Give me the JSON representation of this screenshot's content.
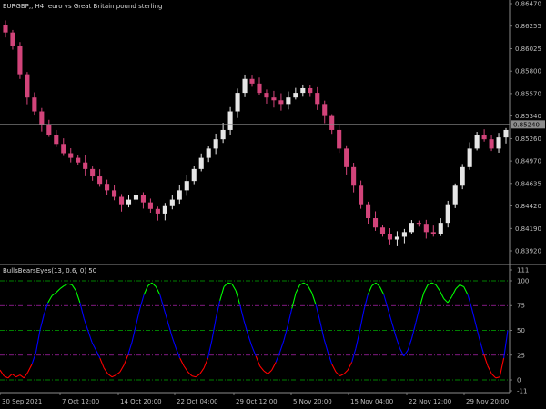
{
  "chart": {
    "title": "EURGBP,, H4:  euro vs Great Britain pound sterling",
    "price_axis_labels": [
      "0.86470",
      "0.86255",
      "0.86025",
      "0.85800",
      "0.85570",
      "0.85340",
      "0.85260",
      "0.84970",
      "0.84635",
      "0.84420",
      "0.84190",
      "0.83920"
    ],
    "current_price_label": "0.85240",
    "price_axis_range": [
      0.838,
      0.8656
    ],
    "current_price": 0.8526,
    "colors": {
      "background": "#000000",
      "bull": "#e6e6e6",
      "bear": "#d2447a",
      "separator": "#8c8c8c",
      "current_line": "#8c8c8c"
    }
  },
  "indicator": {
    "label": "BullsBearsEyes(13, 0.6, 0) 50",
    "axis_labels": [
      "111",
      "100",
      "75",
      "50",
      "25",
      "0",
      "-11"
    ],
    "range": [
      -11,
      111
    ],
    "levels": [
      100,
      75,
      50,
      25,
      0
    ],
    "colors": {
      "high": "#00ff00",
      "mid": "#0000ff",
      "low": "#ff0000",
      "level_100": "#00aa00",
      "level_75": "#aa22aa",
      "level_50": "#00aa00",
      "level_25": "#aa22aa",
      "level_0": "#00aa00"
    }
  },
  "time_axis": {
    "labels": [
      "30 Sep 2021",
      "7 Oct 12:00",
      "14 Oct 20:00",
      "22 Oct 04:00",
      "29 Oct 12:00",
      "5 Nov 20:00",
      "15 Nov 04:00",
      "22 Nov 12:00",
      "29 Nov 20:00"
    ]
  },
  "chart_data": {
    "type": "line",
    "series": [
      {
        "values": [
          0.8625,
          0.861,
          0.858,
          0.8555,
          0.854,
          0.8525,
          0.8515,
          0.8505,
          0.8495,
          0.849,
          0.8485,
          0.8478,
          0.847,
          0.8462,
          0.8455,
          0.8448,
          0.844,
          0.8445,
          0.845,
          0.8442,
          0.8435,
          0.843,
          0.8438,
          0.8445,
          0.8455,
          0.8465,
          0.8478,
          0.849,
          0.85,
          0.851,
          0.852,
          0.854,
          0.856,
          0.8575,
          0.857,
          0.856,
          0.8555,
          0.8552,
          0.8548,
          0.8555,
          0.856,
          0.8565,
          0.856,
          0.8548,
          0.8535,
          0.852,
          0.85,
          0.848,
          0.846,
          0.844,
          0.8425,
          0.8415,
          0.8408,
          0.8402,
          0.8405,
          0.841,
          0.842,
          0.8418,
          0.841,
          0.8408,
          0.842,
          0.844,
          0.846,
          0.848,
          0.85,
          0.8515,
          0.851,
          0.85,
          0.8512,
          0.852
        ]
      }
    ],
    "indicator_series": [
      {
        "values": [
          10,
          4,
          2,
          6,
          3,
          5,
          2,
          8,
          16,
          28,
          50,
          66,
          78,
          85,
          88,
          92,
          95,
          97,
          96,
          90,
          78,
          62,
          50,
          38,
          30,
          22,
          12,
          6,
          3,
          5,
          8,
          15,
          25,
          38,
          55,
          72,
          86,
          95,
          98,
          94,
          86,
          72,
          58,
          44,
          32,
          22,
          14,
          8,
          4,
          3,
          6,
          12,
          22,
          40,
          62,
          80,
          94,
          98,
          97,
          90,
          76,
          60,
          46,
          34,
          24,
          14,
          9,
          6,
          10,
          18,
          28,
          40,
          55,
          72,
          88,
          96,
          98,
          95,
          88,
          76,
          60,
          42,
          28,
          16,
          8,
          4,
          6,
          10,
          18,
          32,
          50,
          70,
          86,
          95,
          98,
          94,
          86,
          72,
          58,
          44,
          32,
          24,
          30,
          42,
          58,
          74,
          88,
          96,
          98,
          96,
          90,
          82,
          78,
          84,
          92,
          96,
          94,
          86,
          72,
          56,
          40,
          26,
          14,
          6,
          2,
          3,
          22,
          50
        ]
      }
    ]
  }
}
